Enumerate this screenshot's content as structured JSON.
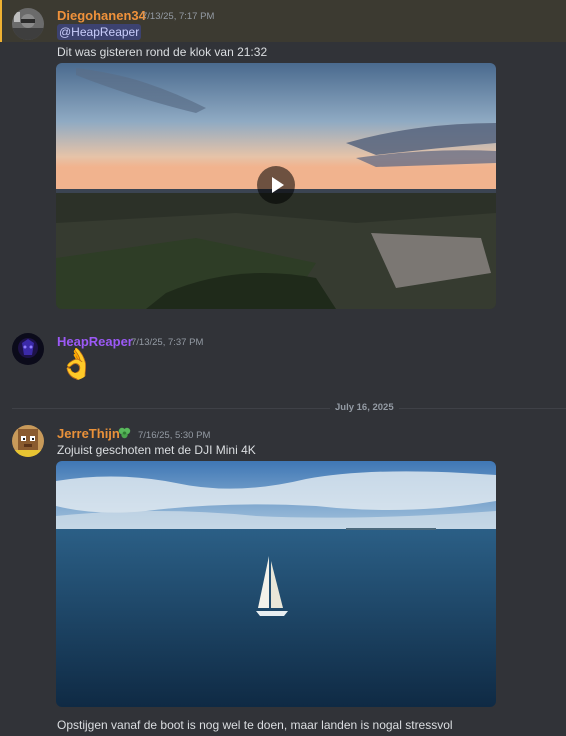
{
  "messages": [
    {
      "username": "Diegohanen34",
      "username_color": "#f0923b",
      "timestamp": "7/13/25, 7:17 PM",
      "mention": "@HeapReaper",
      "text": "Dit was gisteren rond de klok van 21:32",
      "attachment": "video"
    },
    {
      "username": "HeapReaper",
      "username_color": "#9b59f5",
      "timestamp": "7/13/25, 7:37 PM",
      "emoji": "👌"
    },
    {
      "username": "JerreThijn",
      "username_color": "#e9913a",
      "timestamp": "7/16/25, 5:30 PM",
      "text": "Zojuist geschoten met de DJI Mini 4K",
      "attachment": "image",
      "followup_text": "Opstijgen vanaf de boot is nog wel te doen, maar landen is nogal stressvol"
    }
  ],
  "date_divider": "July 16, 2025",
  "icons": {
    "play": "play-icon",
    "badge": "clover-badge-icon"
  }
}
